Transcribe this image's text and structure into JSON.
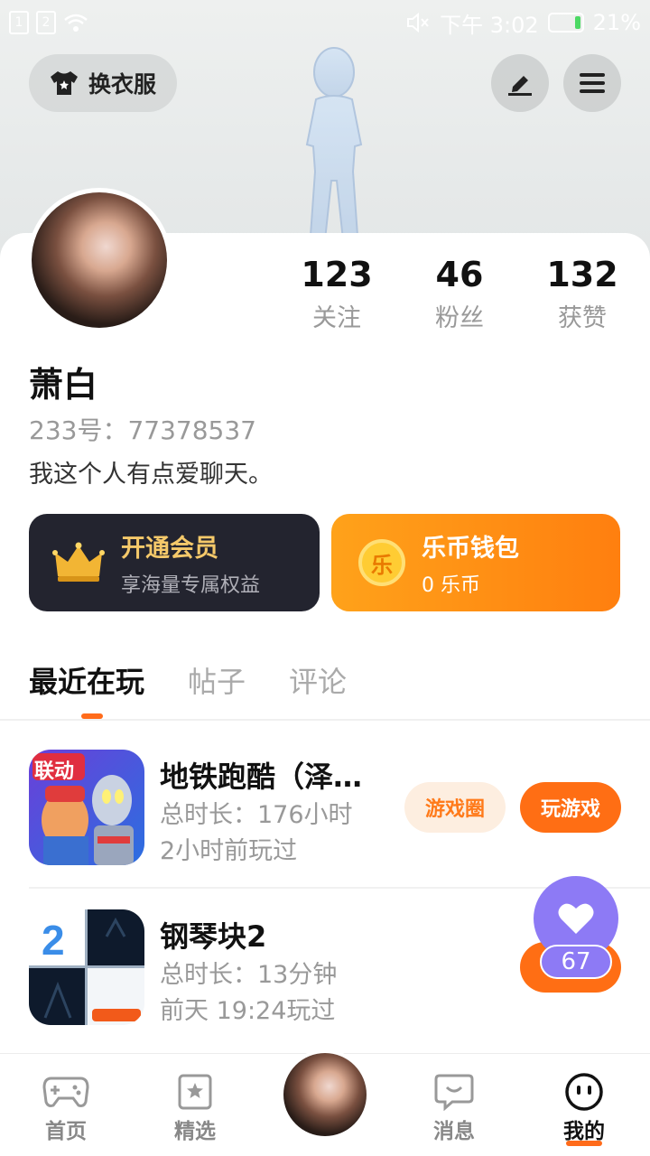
{
  "status_bar": {
    "sim1": "1",
    "sim2": "2",
    "time": "下午 3:02",
    "battery": "21%"
  },
  "header": {
    "outfit_label": "换衣服"
  },
  "profile": {
    "following_count": "123",
    "following_label": "关注",
    "fans_count": "46",
    "fans_label": "粉丝",
    "likes_count": "132",
    "likes_label": "获赞",
    "name": "萧白",
    "uid": "233号：77378537",
    "bio": "我这个人有点爱聊天。"
  },
  "cards": {
    "vip_title": "开通会员",
    "vip_sub": "享海量专属权益",
    "wallet_coin": "乐",
    "wallet_title": "乐币钱包",
    "wallet_sub": "0 乐币"
  },
  "tabs": [
    "最近在玩",
    "帖子",
    "评论"
  ],
  "games": [
    {
      "title": "地铁跑酷（泽…",
      "duration": "总时长：176小时",
      "last_played": "2小时前玩过",
      "badge": "联动",
      "circle_btn": "游戏圈",
      "play_btn": "玩游戏"
    },
    {
      "title": "钢琴块2",
      "duration": "总时长：13分钟",
      "last_played": "前天 19:24玩过"
    }
  ],
  "floating_like": {
    "count": "67"
  },
  "bottom_nav": {
    "home": "首页",
    "featured": "精选",
    "messages": "消息",
    "mine": "我的"
  },
  "colors": {
    "accent": "#ff6e14",
    "vip_bg": "#23242f",
    "vip_text": "#f5c96a",
    "like_fab": "#8d7af5"
  }
}
